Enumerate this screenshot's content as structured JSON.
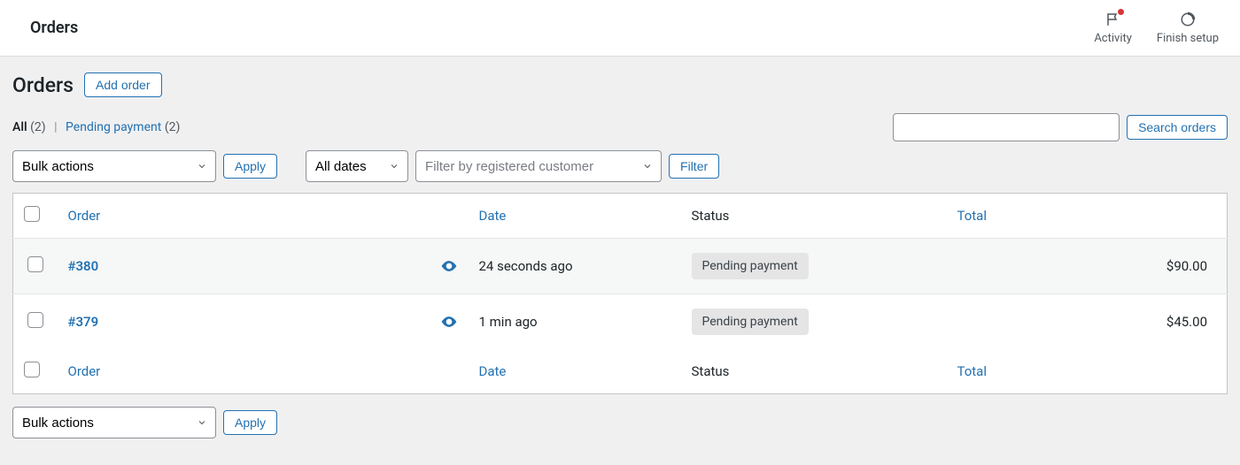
{
  "topbar": {
    "title": "Orders",
    "actions": {
      "activity": "Activity",
      "finish_setup": "Finish setup"
    }
  },
  "page": {
    "title": "Orders",
    "add_order": "Add order"
  },
  "filter_tabs": {
    "all_label": "All",
    "all_count": "(2)",
    "sep": "|",
    "pending_label": "Pending payment",
    "pending_count": "(2)"
  },
  "search": {
    "button": "Search orders"
  },
  "controls": {
    "bulk": "Bulk actions",
    "apply": "Apply",
    "dates": "All dates",
    "customer_placeholder": "Filter by registered customer",
    "filter": "Filter"
  },
  "columns": {
    "order": "Order",
    "date": "Date",
    "status": "Status",
    "total": "Total"
  },
  "rows": [
    {
      "id": "#380",
      "date": "24 seconds ago",
      "status": "Pending payment",
      "total": "$90.00"
    },
    {
      "id": "#379",
      "date": "1 min ago",
      "status": "Pending payment",
      "total": "$45.00"
    }
  ]
}
